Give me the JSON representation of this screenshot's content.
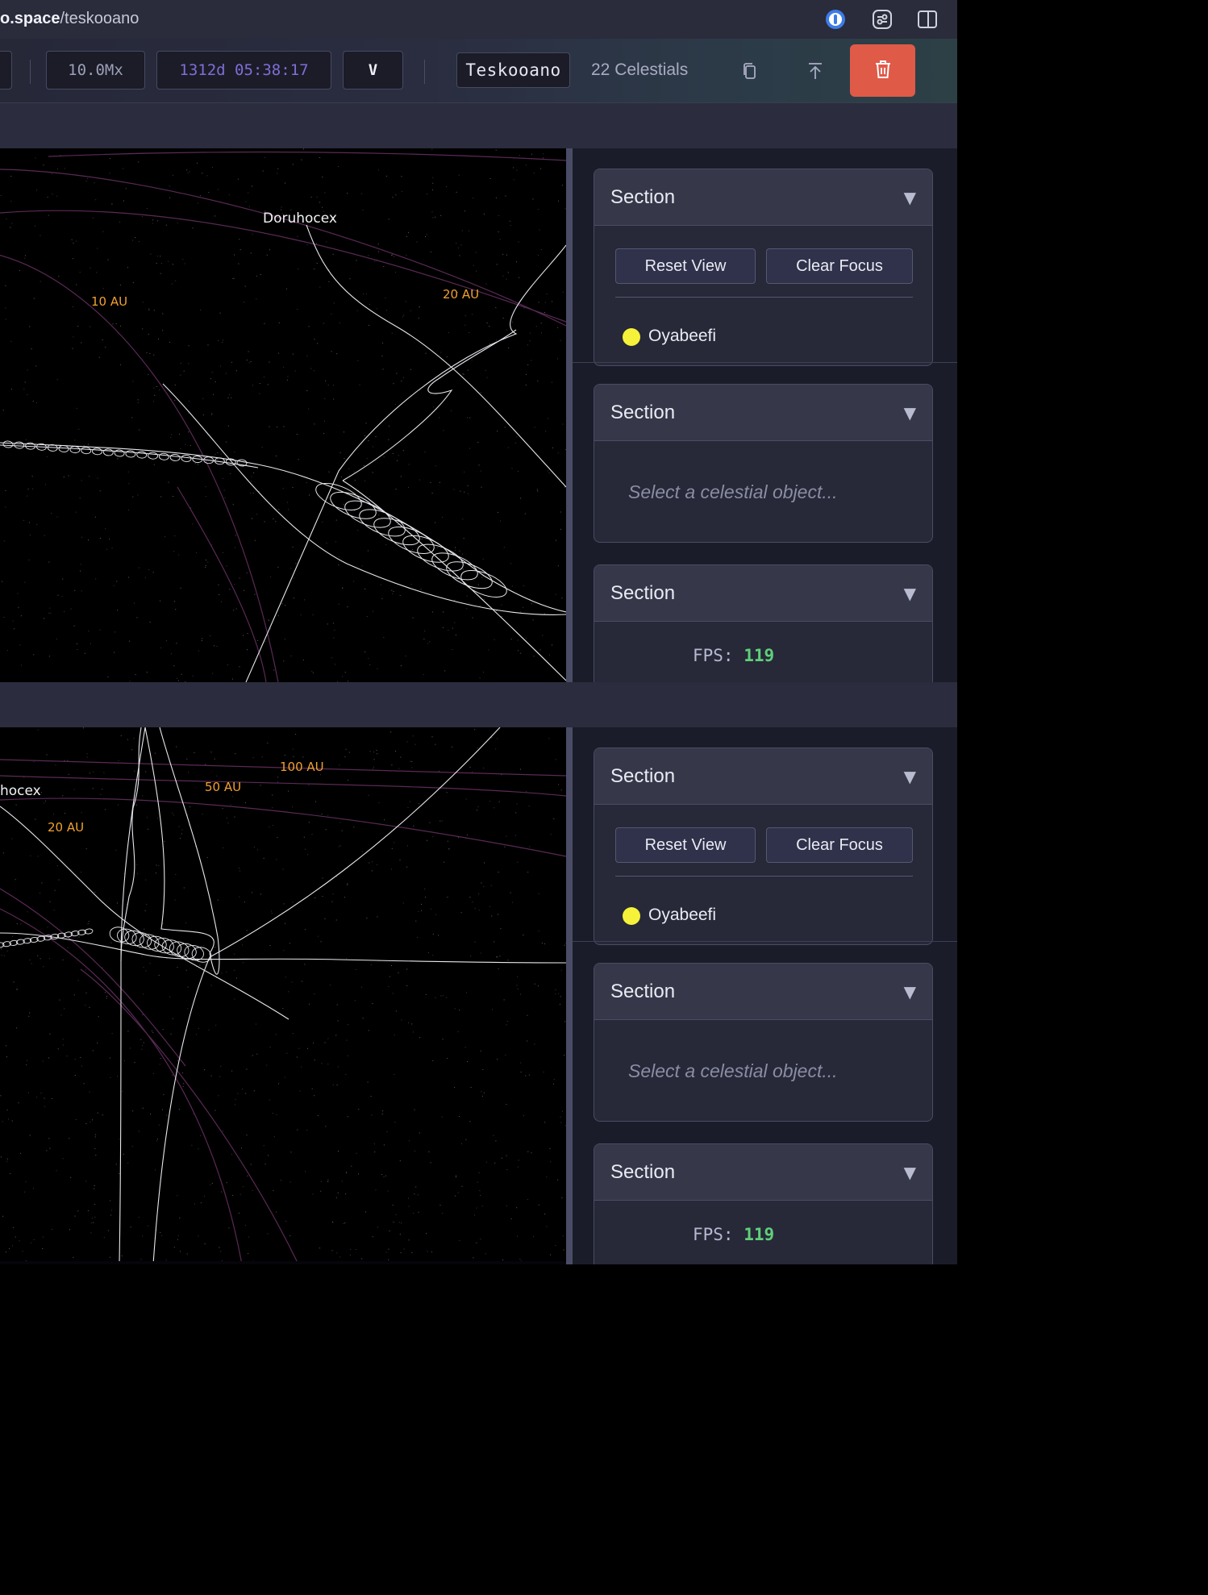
{
  "browser": {
    "url_bold": "o.space",
    "url_path": "/teskooano",
    "icons": [
      "password-manager-icon",
      "extensions-icon",
      "sidebar-toggle-icon"
    ]
  },
  "toolbar": {
    "speed": "10.0Mx",
    "sim_time": "1312d 05:38:17",
    "view_mode": "V",
    "system_name": "Teskooano",
    "celestial_count": "22 Celestials",
    "icons": [
      "copy-icon",
      "export-icon",
      "trash-icon"
    ],
    "delete_color": "#e05a48"
  },
  "views": [
    {
      "labels": {
        "object": "Doruhocex",
        "ring_10": "10 AU",
        "ring_20": "20 AU"
      },
      "panel": {
        "section_1": {
          "title": "Section",
          "reset_label": "Reset View",
          "clear_label": "Clear Focus",
          "object_name": "Oyabeefi"
        },
        "section_2": {
          "title": "Section",
          "placeholder": "Select a celestial object..."
        },
        "section_3": {
          "title": "Section",
          "fps_label": "FPS:",
          "fps_value": "119"
        }
      }
    },
    {
      "labels": {
        "object": "hocex",
        "ring_20": "20 AU",
        "ring_50": "50 AU",
        "ring_100": "100 AU"
      },
      "panel": {
        "section_1": {
          "title": "Section",
          "reset_label": "Reset View",
          "clear_label": "Clear Focus",
          "object_name": "Oyabeefi"
        },
        "section_2": {
          "title": "Section",
          "placeholder": "Select a celestial object..."
        },
        "section_3": {
          "title": "Section",
          "fps_label": "FPS:",
          "fps_value": "119"
        }
      }
    }
  ],
  "colors": {
    "ring_label": "#f2a030",
    "orbit_ring": "#5a2a55",
    "focus_dot": "#f6f23a",
    "fps_value": "#5fd07a"
  }
}
